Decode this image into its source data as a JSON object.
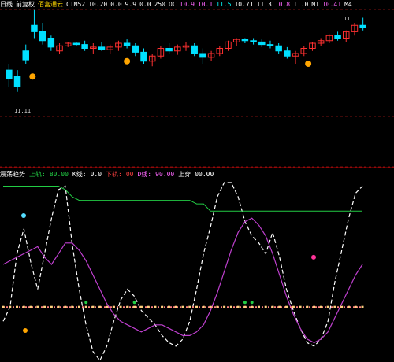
{
  "colors": {
    "background": "#000000",
    "up_candle": "#ff3030",
    "down_candle": "#00e0ff",
    "ma_line": "#e8e8e8",
    "k_line": "#ffffff",
    "d_line": "#c040d0",
    "upper_band": "#22cc44",
    "zero_line": "#ff7070",
    "marker_dot": "#ffd27f"
  },
  "top_header": {
    "items": [
      {
        "text": "日线",
        "color": "#ffffff"
      },
      {
        "text": "前复权",
        "color": "#ffffff"
      },
      {
        "text": "佰富通云",
        "color": "#ffd800"
      },
      {
        "text": "CTM52",
        "color": "#ffffff"
      },
      {
        "text": "10.20",
        "color": "#ffffff"
      },
      {
        "text": "0.0",
        "color": "#ffffff"
      },
      {
        "text": "9.9",
        "color": "#ffffff"
      },
      {
        "text": "0.0",
        "color": "#ffffff"
      },
      {
        "text": "250",
        "color": "#ffffff"
      },
      {
        "text": "OC",
        "color": "#ffffff"
      },
      {
        "text": "10.9",
        "color": "#ff66ff"
      },
      {
        "text": "10.1",
        "color": "#ff66ff"
      },
      {
        "text": "11.5",
        "color": "#00ffff"
      },
      {
        "text": "10.71",
        "color": "#ffffff"
      },
      {
        "text": "11.3",
        "color": "#ffffff"
      },
      {
        "text": "10.8",
        "color": "#ff66ff"
      },
      {
        "text": "11.0",
        "color": "#ffffff"
      },
      {
        "text": "M1",
        "color": "#ffffff"
      },
      {
        "text": "10.41",
        "color": "#ff66ff"
      },
      {
        "text": "M4",
        "color": "#ffffff"
      }
    ]
  },
  "price_scale_label": "11.11",
  "price_tick_label": "11",
  "sub_header": {
    "items": [
      {
        "text": "震荡趋势",
        "color": "#ffffff"
      },
      {
        "text": "上轨:",
        "color": "#22cc44"
      },
      {
        "text": "80.00",
        "color": "#22cc44"
      },
      {
        "text": "K线:",
        "color": "#ffffff"
      },
      {
        "text": "0.0",
        "color": "#ffffff"
      },
      {
        "text": "下轨:",
        "color": "#ff4040"
      },
      {
        "text": "00",
        "color": "#ff4040"
      },
      {
        "text": "D线:",
        "color": "#ff66ff"
      },
      {
        "text": "90.00",
        "color": "#ff66ff"
      },
      {
        "text": "上穿",
        "color": "#ffffff"
      },
      {
        "text": "00.00",
        "color": "#ffffff"
      }
    ]
  },
  "chart_data": [
    {
      "type": "candlestick",
      "title": "",
      "series": [
        {
          "name": "candles",
          "ohlc": [
            [
              11.25,
              11.3,
              11.12,
              11.18
            ],
            [
              11.2,
              11.25,
              11.08,
              11.12
            ],
            [
              11.4,
              11.45,
              11.3,
              11.33
            ],
            [
              11.6,
              11.72,
              11.5,
              11.55
            ],
            [
              11.55,
              11.62,
              11.45,
              11.48
            ],
            [
              11.5,
              11.52,
              11.4,
              11.43
            ],
            [
              11.4,
              11.46,
              11.38,
              11.44
            ],
            [
              11.44,
              11.47,
              11.43,
              11.46
            ],
            [
              11.46,
              11.47,
              11.44,
              11.45
            ],
            [
              11.45,
              11.48,
              11.4,
              11.42
            ],
            [
              11.42,
              11.46,
              11.38,
              11.43
            ],
            [
              11.43,
              11.47,
              11.4,
              11.41
            ],
            [
              11.41,
              11.45,
              11.38,
              11.43
            ],
            [
              11.43,
              11.48,
              11.4,
              11.46
            ],
            [
              11.46,
              11.49,
              11.42,
              11.44
            ],
            [
              11.44,
              11.46,
              11.36,
              11.39
            ],
            [
              11.39,
              11.42,
              11.3,
              11.32
            ],
            [
              11.32,
              11.38,
              11.28,
              11.36
            ],
            [
              11.36,
              11.44,
              11.34,
              11.42
            ],
            [
              11.42,
              11.46,
              11.38,
              11.4
            ],
            [
              11.4,
              11.45,
              11.37,
              11.43
            ],
            [
              11.43,
              11.47,
              11.4,
              11.44
            ],
            [
              11.44,
              11.46,
              11.36,
              11.38
            ],
            [
              11.38,
              11.42,
              11.3,
              11.35
            ],
            [
              11.35,
              11.4,
              11.32,
              11.38
            ],
            [
              11.38,
              11.44,
              11.36,
              11.42
            ],
            [
              11.42,
              11.48,
              11.4,
              11.47
            ],
            [
              11.47,
              11.5,
              11.44,
              11.49
            ],
            [
              11.49,
              11.5,
              11.46,
              11.48
            ],
            [
              11.48,
              11.5,
              11.45,
              11.47
            ],
            [
              11.47,
              11.49,
              11.43,
              11.45
            ],
            [
              11.45,
              11.48,
              11.42,
              11.44
            ],
            [
              11.44,
              11.46,
              11.38,
              11.4
            ],
            [
              11.4,
              11.43,
              11.34,
              11.36
            ],
            [
              11.36,
              11.4,
              11.3,
              11.38
            ],
            [
              11.38,
              11.44,
              11.36,
              11.42
            ],
            [
              11.42,
              11.47,
              11.4,
              11.46
            ],
            [
              11.46,
              11.5,
              11.44,
              11.48
            ],
            [
              11.48,
              11.53,
              11.46,
              11.52
            ],
            [
              11.52,
              11.55,
              11.48,
              11.5
            ],
            [
              11.5,
              11.56,
              11.47,
              11.55
            ],
            [
              11.55,
              11.62,
              11.52,
              11.6
            ],
            [
              11.6,
              11.66,
              11.56,
              11.58
            ]
          ]
        }
      ],
      "ylim": [
        10.9,
        11.7
      ]
    },
    {
      "type": "line",
      "title": "",
      "ylim": [
        0,
        100
      ],
      "series": [
        {
          "name": "K",
          "values": [
            22,
            30,
            60,
            74,
            55,
            40,
            60,
            80,
            96,
            98,
            65,
            40,
            20,
            5,
            0,
            8,
            22,
            34,
            40,
            36,
            28,
            24,
            20,
            14,
            10,
            8,
            12,
            22,
            40,
            60,
            75,
            92,
            100,
            100,
            92,
            78,
            70,
            66,
            60,
            72,
            58,
            40,
            28,
            18,
            10,
            8,
            12,
            22,
            44,
            62,
            80,
            94,
            98
          ]
        },
        {
          "name": "D",
          "values": [
            54,
            56,
            58,
            60,
            62,
            64,
            58,
            54,
            60,
            66,
            66,
            62,
            56,
            48,
            40,
            32,
            26,
            22,
            20,
            18,
            16,
            18,
            20,
            20,
            18,
            16,
            14,
            14,
            16,
            20,
            28,
            38,
            50,
            62,
            72,
            78,
            80,
            76,
            70,
            60,
            48,
            36,
            26,
            18,
            12,
            10,
            12,
            16,
            24,
            32,
            40,
            48,
            54
          ]
        },
        {
          "name": "upper",
          "values": [
            98,
            98,
            98,
            98,
            98,
            98,
            98,
            98,
            98,
            96,
            92,
            90,
            90,
            90,
            90,
            90,
            90,
            90,
            90,
            90,
            90,
            90,
            90,
            90,
            90,
            90,
            90,
            90,
            88,
            88,
            84,
            84,
            84,
            84,
            84,
            84,
            84,
            84,
            84,
            84,
            84,
            84,
            84,
            84,
            84,
            84,
            84,
            84,
            84,
            84,
            84,
            84,
            84
          ]
        },
        {
          "name": "mid",
          "values": [
            30,
            30,
            30,
            30,
            30,
            30,
            30,
            30,
            30,
            30,
            30,
            30,
            30,
            30,
            30,
            30,
            30,
            30,
            30,
            30,
            30,
            30,
            30,
            30,
            30,
            30,
            30,
            30,
            30,
            30,
            30,
            30,
            30,
            30,
            30,
            30,
            30,
            30,
            30,
            30,
            30,
            30,
            30,
            30,
            30,
            30,
            30,
            30,
            30,
            30,
            30,
            30,
            30
          ]
        }
      ]
    }
  ]
}
